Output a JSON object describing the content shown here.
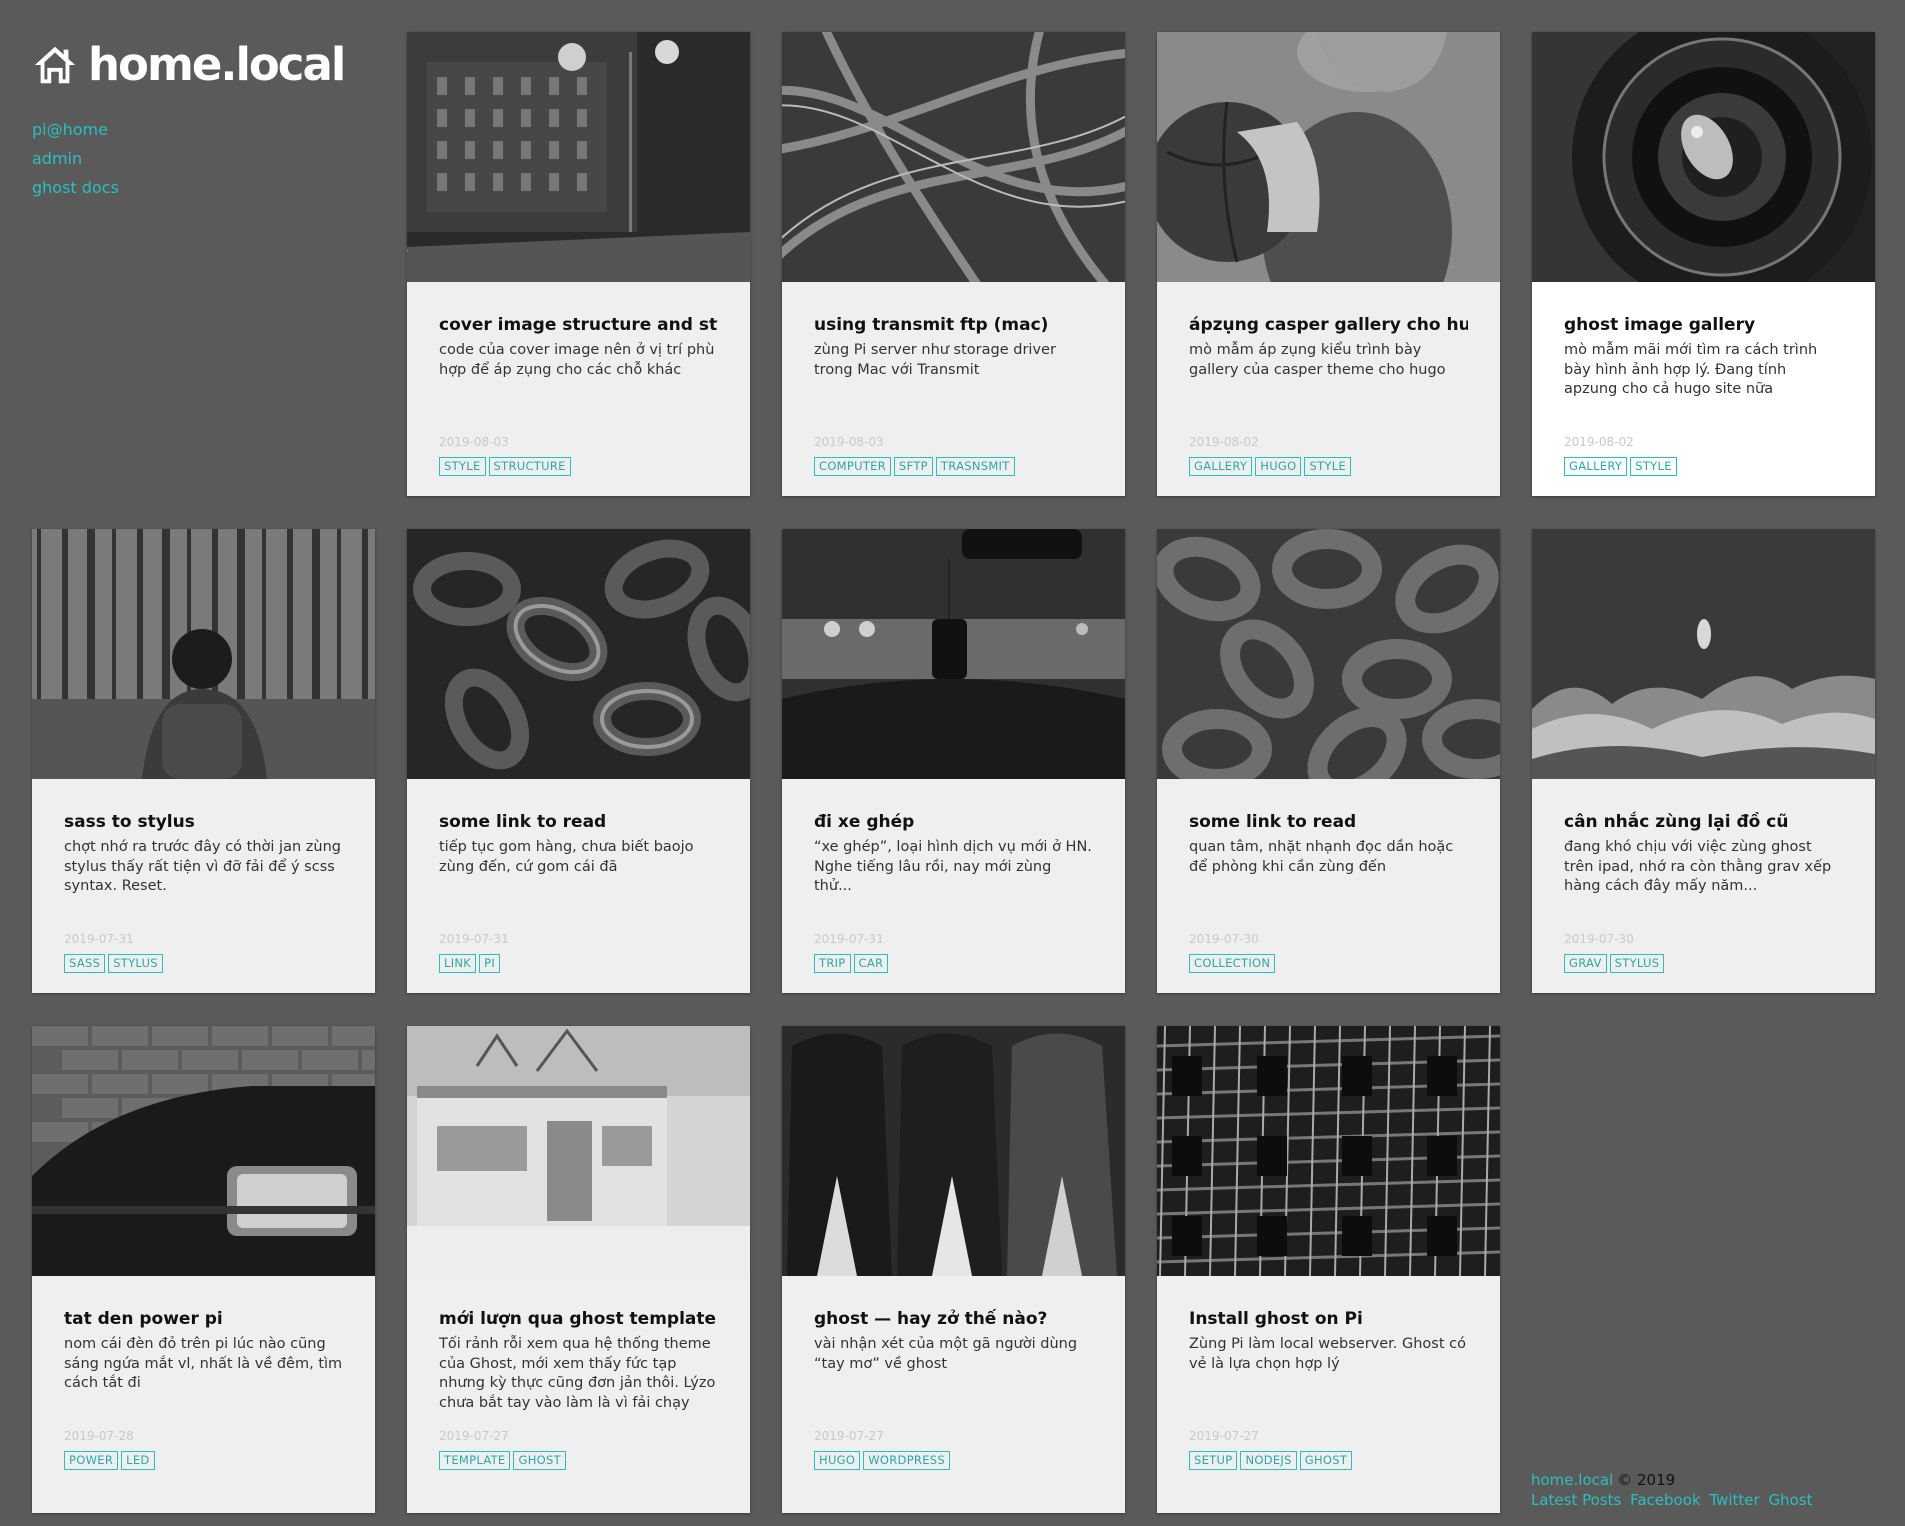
{
  "site": {
    "title": "home.local",
    "nav": [
      "pi@home",
      "admin",
      "ghost docs"
    ]
  },
  "posts": [
    {
      "title": "cover image structure and style",
      "excerpt": "code của cover image nên ở vị trí phù hợp để áp zụng cho các chỗ khác",
      "date": "2019-08-03",
      "tags": [
        "STYLE",
        "STRUCTURE"
      ],
      "image": "night-street-photo"
    },
    {
      "title": "using transmit ftp (mac)",
      "excerpt": "zùng Pi server như storage driver trong Mac với Transmit",
      "date": "2019-08-03",
      "tags": [
        "COMPUTER",
        "SFTP",
        "TRASNSMIT"
      ],
      "image": "highway-interchange-photo"
    },
    {
      "title": "ápzụng casper gallery cho hugo",
      "excerpt": "mò mẫm áp zụng kiểu trình bày gallery của casper theme cho hugo",
      "date": "2019-08-02",
      "tags": [
        "GALLERY",
        "HUGO",
        "STYLE"
      ],
      "image": "woman-basketball-photo"
    },
    {
      "title": "ghost image gallery",
      "excerpt": "mò mẫm mãi mới tìm ra cách trình bày hình ảnh hợp lý. Đang tính apzung cho cả hugo site nữa",
      "date": "2019-08-02",
      "tags": [
        "GALLERY",
        "STYLE"
      ],
      "image": "camera-lens-photo"
    },
    {
      "title": "sass to stylus",
      "excerpt": "chợt nhớ ra trước đây có thời jan zùng stylus thấy rất tiện vì đỡ fải để ý scss syntax. Reset.",
      "date": "2019-07-31",
      "tags": [
        "SASS",
        "STYLUS"
      ],
      "image": "forest-hiker-photo"
    },
    {
      "title": "some link to read",
      "excerpt": "tiếp tục gom hàng, chưa biết baojo zùng đến, cứ gom cái đã",
      "date": "2019-07-31",
      "tags": [
        "LINK",
        "PI"
      ],
      "image": "chain-photo"
    },
    {
      "title": "đi xe ghép",
      "excerpt": "“xe ghép”, loại hình dịch vụ mới ở HN. Nghe tiếng lâu rồi, nay mới zùng thử...",
      "date": "2019-07-31",
      "tags": [
        "TRIP",
        "CAR"
      ],
      "image": "car-windshield-photo"
    },
    {
      "title": "some link to read",
      "excerpt": "quan tâm, nhặt nhạnh đọc dần hoặc để phòng khi cần zùng đến",
      "date": "2019-07-30",
      "tags": [
        "COLLECTION"
      ],
      "image": "chain-pile-photo"
    },
    {
      "title": "cân nhắc zùng lại đồ cũ",
      "excerpt": "đang khó chịu với việc zùng ghost trên ipad, nhớ ra còn thằng grav xếp hàng cách đây mấy năm...",
      "date": "2019-07-30",
      "tags": [
        "GRAV",
        "STYLUS"
      ],
      "image": "aerial-beach-photo"
    },
    {
      "title": "tat den power pi",
      "excerpt": "nom cái đèn đỏ trên pi lúc nào cũng sáng ngứa mắt vl, nhất là về đêm, tìm cách tắt đi",
      "date": "2019-07-28",
      "tags": [
        "POWER",
        "LED"
      ],
      "image": "car-headlight-photo"
    },
    {
      "title": "mới lượn qua ghost template",
      "excerpt": "Tối rảnh rỗi xem qua hệ thống theme của Ghost, mới xem thấy fức tạp nhưng kỳ thực cũng đơn jản thôi. Lýzo chưa bắt tay vào làm là vì fải chạy gulp",
      "date": "2019-07-27",
      "tags": [
        "TEMPLATE",
        "GHOST"
      ],
      "image": "small-house-photo"
    },
    {
      "title": "ghost — hay zở thế nào?",
      "excerpt": "vài nhận xét của một gã người dùng “tay mơ” về ghost",
      "date": "2019-07-27",
      "tags": [
        "HUGO",
        "WORDPRESS"
      ],
      "image": "paint-swatches-photo"
    },
    {
      "title": "Install ghost on Pi",
      "excerpt": "Zùng Pi làm local webserver. Ghost có vẻ là lựa chọn hợp lý",
      "date": "2019-07-27",
      "tags": [
        "SETUP",
        "NODEJS",
        "GHOST"
      ],
      "image": "server-ceiling-photo"
    }
  ],
  "footer": {
    "site": "home.local",
    "copyright": "© 2019",
    "links": [
      "Latest Posts",
      "Facebook",
      "Twitter",
      "Ghost"
    ]
  }
}
